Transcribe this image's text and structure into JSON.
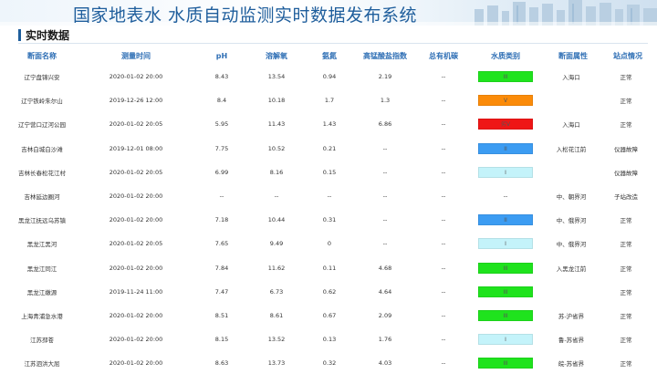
{
  "header": {
    "title": "国家地表水 水质自动监测实时数据发布系统",
    "section_title": "实时数据"
  },
  "columns": [
    "断面名称",
    "测量时间",
    "pH",
    "溶解氧",
    "氨氮",
    "高锰酸盐指数",
    "总有机碳",
    "水质类别",
    "断面属性",
    "站点情况"
  ],
  "colors": {
    "class_I": "#c4f3fa",
    "class_II": "#3c9cf2",
    "class_III": "#1fe31d",
    "class_IV": "#fbeb0a",
    "class_V": "#fb8b09",
    "class_worse_V": "#ef1616",
    "header_text": "#2f6fb5",
    "title_text": "#1f5e9c"
  },
  "rows": [
    {
      "name": "辽宁盘锦兴安",
      "time": "2020-01-02 20:00",
      "ph": "8.43",
      "do": "13.54",
      "nh": "0.94",
      "mn": "2.19",
      "toc": "--",
      "cls": "III",
      "color": "#1fe31d",
      "attr": "入海口",
      "status": "正常"
    },
    {
      "name": "辽宁铁岭朱尔山",
      "time": "2019-12-26 12:00",
      "ph": "8.4",
      "do": "10.18",
      "nh": "1.7",
      "mn": "1.3",
      "toc": "--",
      "cls": "V",
      "color": "#fb8b09",
      "attr": "",
      "status": "正常"
    },
    {
      "name": "辽宁营口辽河公园",
      "time": "2020-01-02 20:05",
      "ph": "5.95",
      "do": "11.43",
      "nh": "1.43",
      "mn": "6.86",
      "toc": "--",
      "cls": "劣V",
      "color": "#ef1616",
      "attr": "入海口",
      "status": "正常"
    },
    {
      "name": "吉林白城白沙滩",
      "time": "2019-12-01 08:00",
      "ph": "7.75",
      "do": "10.52",
      "nh": "0.21",
      "mn": "--",
      "toc": "--",
      "cls": "II",
      "color": "#3c9cf2",
      "attr": "入松花江前",
      "status": "仪器故障"
    },
    {
      "name": "吉林长春松花江村",
      "time": "2020-01-02 20:05",
      "ph": "6.99",
      "do": "8.16",
      "nh": "0.15",
      "mn": "--",
      "toc": "--",
      "cls": "I",
      "color": "#c4f3fa",
      "attr": "",
      "status": "仪器故障"
    },
    {
      "name": "吉林延边圈河",
      "time": "2020-01-02 20:00",
      "ph": "--",
      "do": "--",
      "nh": "--",
      "mn": "--",
      "toc": "--",
      "cls": "--",
      "color": "",
      "attr": "中、朝界河",
      "status": "子站改造"
    },
    {
      "name": "黑龙江抚远乌苏镇",
      "time": "2020-01-02 20:00",
      "ph": "7.18",
      "do": "10.44",
      "nh": "0.31",
      "mn": "--",
      "toc": "--",
      "cls": "II",
      "color": "#3c9cf2",
      "attr": "中、俄界河",
      "status": "正常"
    },
    {
      "name": "黑龙江黑河",
      "time": "2020-01-02 20:05",
      "ph": "7.65",
      "do": "9.49",
      "nh": "0",
      "mn": "--",
      "toc": "--",
      "cls": "I",
      "color": "#c4f3fa",
      "attr": "中、俄界河",
      "status": "正常"
    },
    {
      "name": "黑龙江同江",
      "time": "2020-01-02 20:00",
      "ph": "7.84",
      "do": "11.62",
      "nh": "0.11",
      "mn": "4.68",
      "toc": "--",
      "cls": "III",
      "color": "#1fe31d",
      "attr": "入黑龙江前",
      "status": "正常"
    },
    {
      "name": "黑龙江嫩源",
      "time": "2019-11-24 11:00",
      "ph": "7.47",
      "do": "6.73",
      "nh": "0.62",
      "mn": "4.64",
      "toc": "--",
      "cls": "III",
      "color": "#1fe31d",
      "attr": "",
      "status": "正常"
    },
    {
      "name": "上海青浦急水港",
      "time": "2020-01-02 20:00",
      "ph": "8.51",
      "do": "8.61",
      "nh": "0.67",
      "mn": "2.09",
      "toc": "--",
      "cls": "III",
      "color": "#1fe31d",
      "attr": "苏-沪省界",
      "status": "正常"
    },
    {
      "name": "江苏邳苍",
      "time": "2020-01-02 20:00",
      "ph": "8.15",
      "do": "13.52",
      "nh": "0.13",
      "mn": "1.76",
      "toc": "--",
      "cls": "I",
      "color": "#c4f3fa",
      "attr": "鲁-苏省界",
      "status": "正常"
    },
    {
      "name": "江苏泗洪大屈",
      "time": "2020-01-02 20:00",
      "ph": "8.63",
      "do": "13.73",
      "nh": "0.32",
      "mn": "4.03",
      "toc": "--",
      "cls": "III",
      "color": "#1fe31d",
      "attr": "皖-苏省界",
      "status": "正常"
    }
  ]
}
